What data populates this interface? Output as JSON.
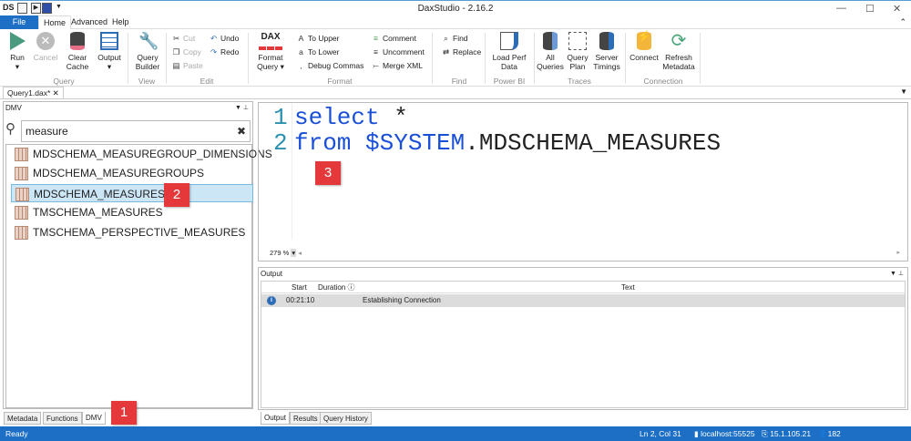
{
  "window": {
    "title": "DaxStudio - 2.16.2"
  },
  "menu_tabs": [
    "File",
    "Home",
    "Advanced",
    "Help"
  ],
  "ribbon": {
    "query": {
      "label": "Query",
      "run": "Run",
      "cancel": "Cancel",
      "clear_cache_1": "Clear",
      "clear_cache_2": "Cache",
      "output": "Output"
    },
    "view": {
      "label": "View",
      "qb1": "Query",
      "qb2": "Builder"
    },
    "edit": {
      "label": "Edit",
      "cut": "Cut",
      "copy": "Copy",
      "paste": "Paste",
      "undo": "Undo",
      "redo": "Redo"
    },
    "format": {
      "label": "Format",
      "logo": "DAX",
      "fq1": "Format",
      "fq2": "Query",
      "to_upper": "To Upper",
      "to_lower": "To Lower",
      "debug_commas": "Debug Commas",
      "comment": "Comment",
      "uncomment": "Uncomment",
      "merge_xml": "Merge XML"
    },
    "find": {
      "label": "Find",
      "find": "Find",
      "replace": "Replace"
    },
    "powerbi": {
      "label": "Power BI",
      "lp1": "Load Perf",
      "lp2": "Data"
    },
    "traces": {
      "label": "Traces",
      "aq1": "All",
      "aq2": "Queries",
      "qp1": "Query",
      "qp2": "Plan",
      "st1": "Server",
      "st2": "Timings"
    },
    "connection": {
      "label": "Connection",
      "connect": "Connect",
      "rm1": "Refresh",
      "rm2": "Metadata"
    }
  },
  "doc_tab": "Query1.dax*",
  "left_panel": {
    "title": "DMV",
    "search": "measure",
    "items": [
      "MDSCHEMA_MEASUREGROUP_DIMENSIONS",
      "MDSCHEMA_MEASUREGROUPS",
      "MDSCHEMA_MEASURES",
      "TMSCHEMA_MEASURES",
      "TMSCHEMA_PERSPECTIVE_MEASURES"
    ],
    "tabs": [
      "Metadata",
      "Functions",
      "DMV"
    ]
  },
  "editor": {
    "line_numbers": [
      "1",
      "2"
    ],
    "line1_kw": "select",
    "line1_rest": " *",
    "line2_kw": "from",
    "line2_rest": " $SYSTEM",
    "line2_tail": ".MDSCHEMA_MEASURES",
    "zoom": "279 %"
  },
  "output": {
    "title": "Output",
    "columns": [
      "Start",
      "Duration",
      "Text"
    ],
    "rows": [
      {
        "start": "00:21:10",
        "duration": "",
        "text": "Establishing Connection"
      }
    ],
    "tabs": [
      "Output",
      "Results",
      "Query History"
    ]
  },
  "badges": [
    "1",
    "2",
    "3"
  ],
  "status": {
    "left": "Ready",
    "position": "Ln 2, Col 31",
    "server": "localhost:55525",
    "version": "15.1.105.21",
    "spid": "182"
  },
  "colors": {
    "accent": "#1c6fc4",
    "badge": "#e5383b",
    "keyword": "#1a50d8"
  }
}
